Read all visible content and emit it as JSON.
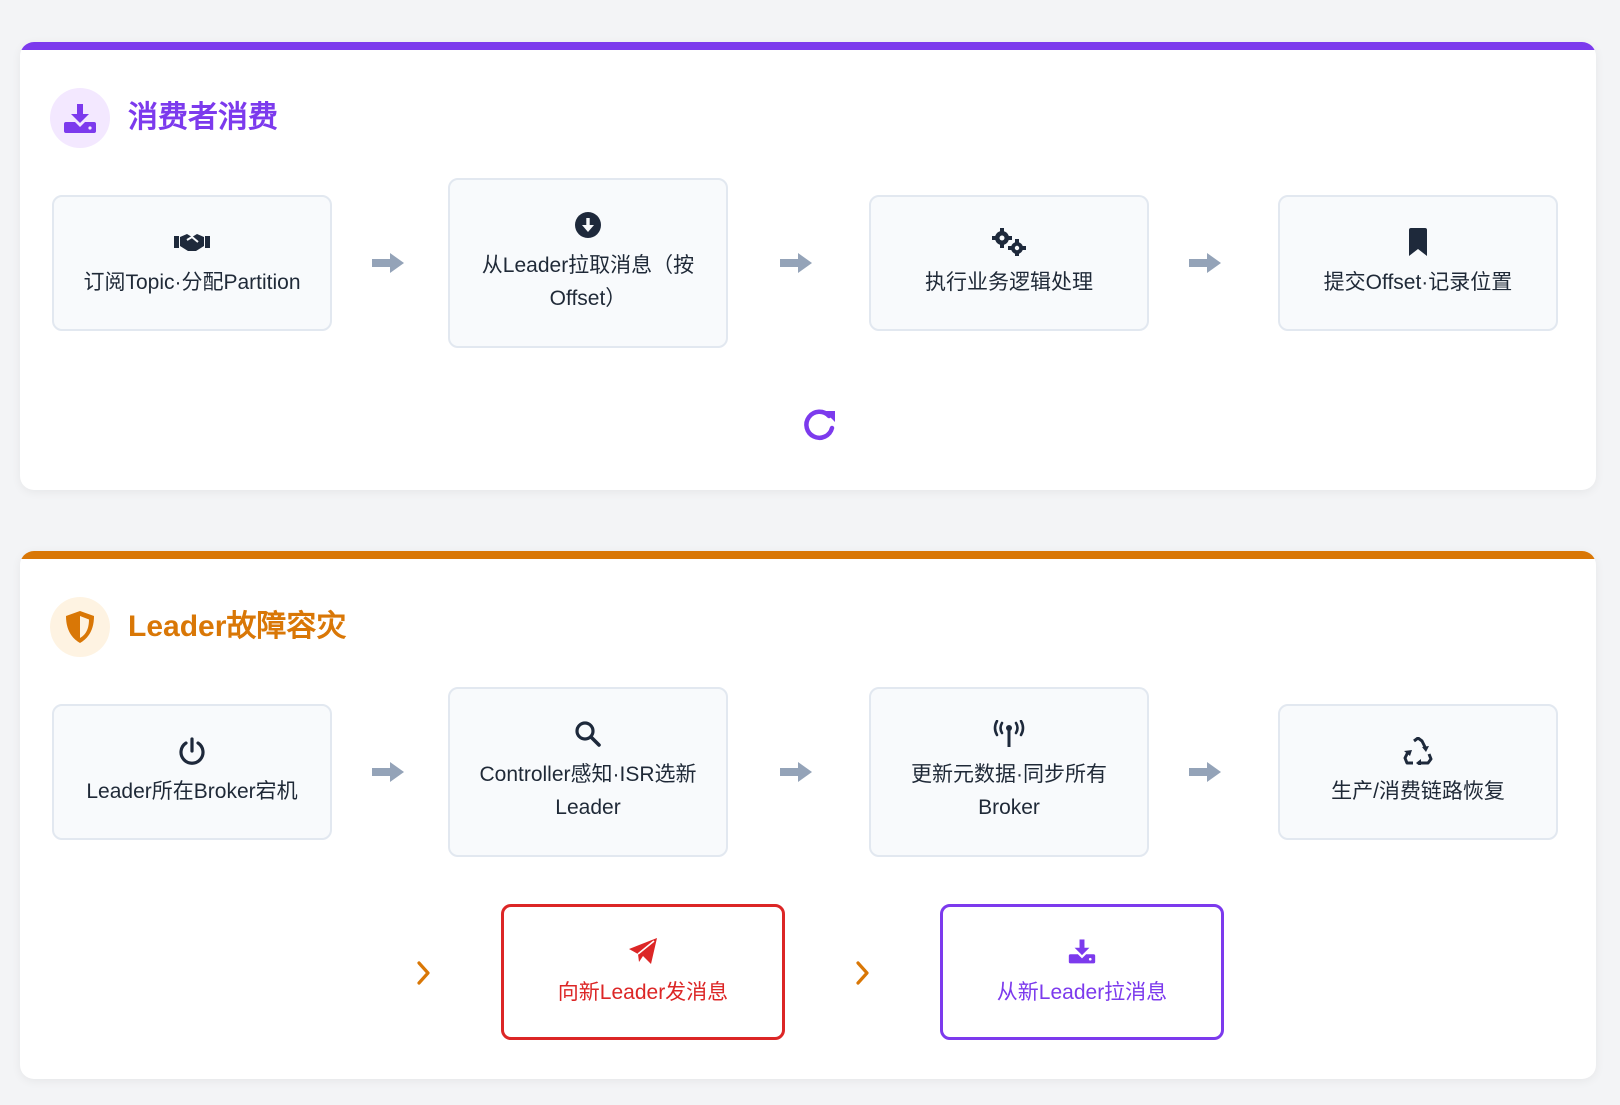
{
  "colors": {
    "purple": "#7c3aed",
    "orange": "#d97706",
    "red": "#dc2626",
    "arrow_gray": "#94a3b8",
    "icon_dark": "#1e293b"
  },
  "consumer_section": {
    "title": "消费者消费",
    "header_icon": "download-icon",
    "steps": [
      {
        "label": "订阅Topic·分配Partition",
        "icon": "handshake-icon"
      },
      {
        "label": "从Leader拉取消息（按Offset）",
        "icon": "arrow-circle-down-icon"
      },
      {
        "label": "执行业务逻辑处理",
        "icon": "gears-icon"
      },
      {
        "label": "提交Offset·记录位置",
        "icon": "bookmark-icon"
      }
    ],
    "loop_icon": "refresh-icon"
  },
  "failover_section": {
    "title": "Leader故障容灾",
    "header_icon": "shield-icon",
    "steps": [
      {
        "label": "Leader所在Broker宕机",
        "icon": "power-icon"
      },
      {
        "label": "Controller感知·ISR选新Leader",
        "icon": "search-icon"
      },
      {
        "label": "更新元数据·同步所有Broker",
        "icon": "broadcast-tower-icon"
      },
      {
        "label": "生产/消费链路恢复",
        "icon": "recycle-icon"
      }
    ],
    "outcomes": [
      {
        "label": "向新Leader发消息",
        "icon": "paper-plane-icon"
      },
      {
        "label": "从新Leader拉消息",
        "icon": "download-icon"
      }
    ]
  }
}
